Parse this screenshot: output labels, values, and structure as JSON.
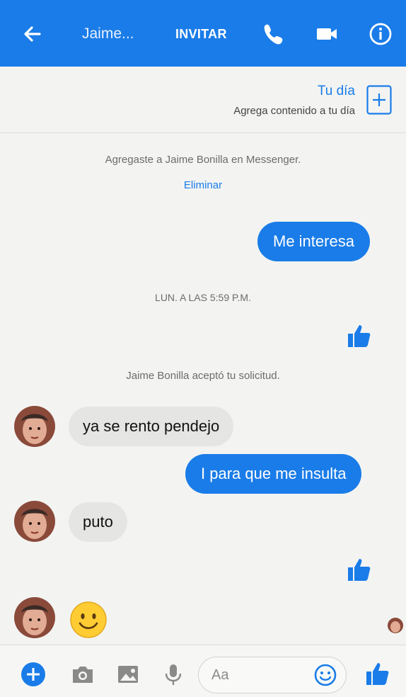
{
  "header": {
    "contact_name": "Jaime...",
    "invite_label": "INVITAR"
  },
  "story": {
    "title": "Tu día",
    "subtitle": "Agrega contenido a tu día"
  },
  "system": {
    "added_text": "Agregaste a Jaime Bonilla en Messenger.",
    "remove_label": "Eliminar",
    "timestamp": "LUN. A LAS 5:59 P.M.",
    "accepted_text": "Jaime Bonilla aceptó tu solicitud."
  },
  "messages": {
    "m1": "Me interesa",
    "m2": "ya se rento pendejo",
    "m3": "I para que me insulta",
    "m4": "puto",
    "m5_emoji": "🙂"
  },
  "composer": {
    "placeholder": "Aa"
  },
  "colors": {
    "accent": "#1a7ce8",
    "incoming_bubble": "#e5e6e4",
    "background": "#f3f4f2"
  }
}
